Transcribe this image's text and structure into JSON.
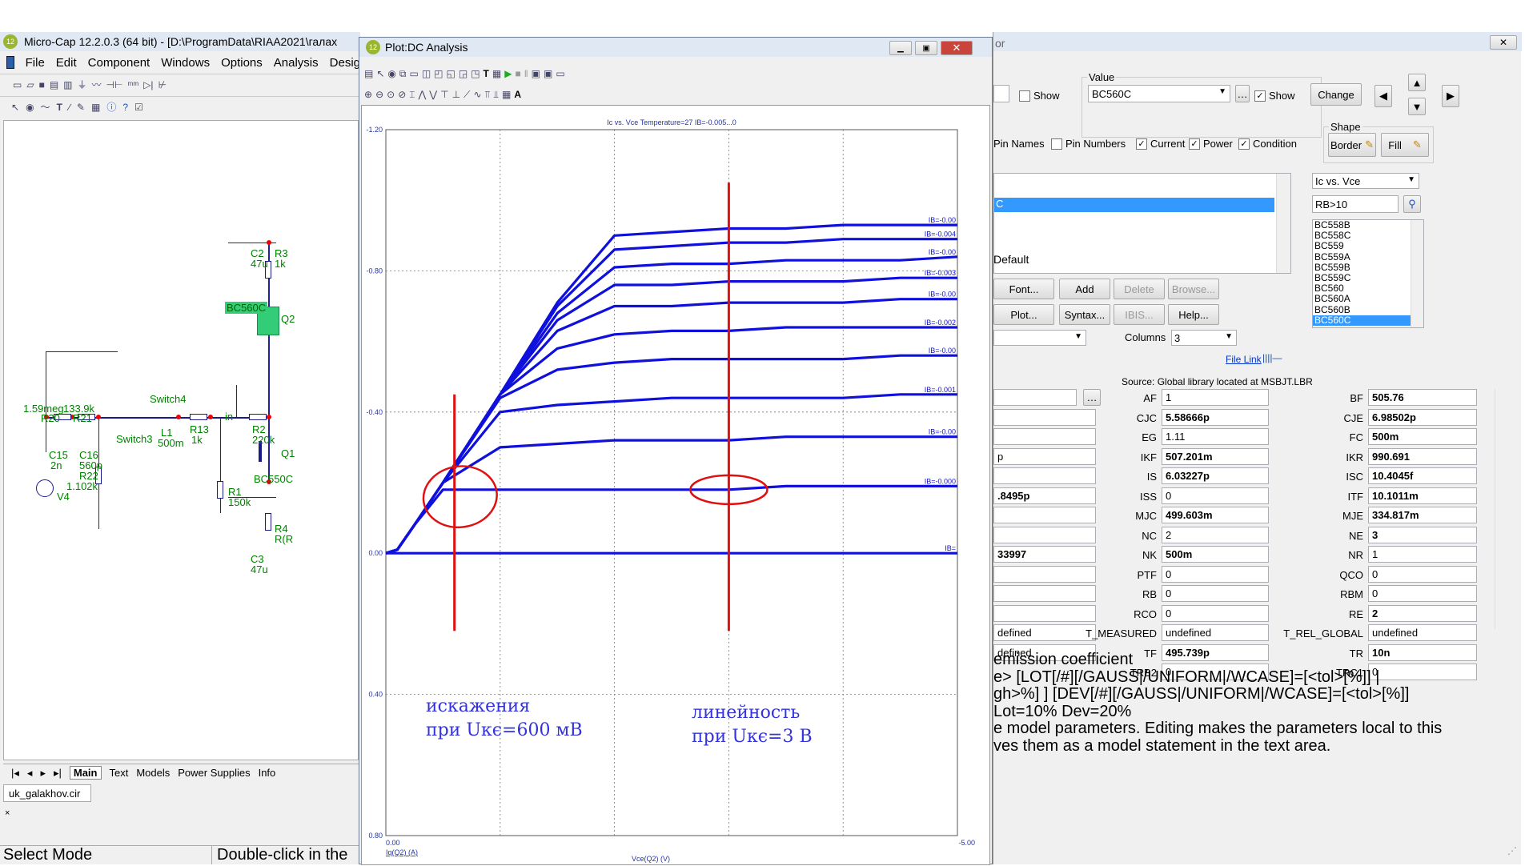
{
  "main": {
    "title": "Micro-Cap 12.2.0.3 (64 bit) - [D:\\ProgramData\\RIAA2021\\галах",
    "menu": [
      "File",
      "Edit",
      "Component",
      "Windows",
      "Options",
      "Analysis",
      "Desig"
    ],
    "tabs": [
      "Main",
      "Text",
      "Models",
      "Power Supplies",
      "Info"
    ],
    "file_tab": "uk_galakhov.cir",
    "status_left": "Select Mode",
    "status_right": "Double-click in the"
  },
  "schematic": {
    "labels": [
      "C2",
      "47u",
      "R3",
      "1k",
      "BC560C",
      "Q2",
      "1.59meg",
      "133.9k",
      "R20",
      "R21",
      "Switch4",
      "in",
      "R2",
      "220k",
      "Switch3",
      "L1",
      "500m",
      "R13",
      "1k",
      "C15",
      "2n",
      "C16",
      "560p",
      "R22",
      "1.102k",
      "V4",
      "Q1",
      "BC550C",
      "R1",
      "150k",
      "R4",
      "R(R",
      "C3",
      "47u"
    ]
  },
  "plot": {
    "title": "Plot:DC Analysis",
    "plot_caption": "Ic vs. Vce Temperature=27 IB=-0.005...0",
    "y_ticks": [
      "-1.20",
      "-0.80",
      "-0.40",
      "0.00",
      "0.40",
      "0.80"
    ],
    "x_ticks": [
      "0.00",
      "-5.00"
    ],
    "x_label": "Vce(Q2) (V)",
    "y_label": "Iq(Q2) (A)",
    "series_labels": [
      "IB=-0.00",
      "IB=-0.004",
      "IB=-0.00",
      "IB=-0.003",
      "IB=-0.00",
      "IB=-0.002",
      "IB=-0.00",
      "IB=-0.001",
      "IB=-0.00",
      "IB=-0.000",
      "IB="
    ],
    "annotation_left": [
      "искажения",
      "при Uкє=600 мВ"
    ],
    "annotation_right": [
      "линейность",
      "при Uкє=3 В"
    ],
    "curve_color": "#1010dd",
    "annotation_color": "#e01010"
  },
  "chart_data": {
    "type": "line",
    "title": "Ic vs. Vce Temperature=27 IB=-0.005...0",
    "xlabel": "Vce(Q2) (V)",
    "ylabel": "Iq(Q2) (A)",
    "xlim": [
      0,
      -5
    ],
    "ylim": [
      -1.2,
      0.8
    ],
    "x": [
      0,
      -0.1,
      -0.25,
      -0.5,
      -1,
      -1.5,
      -2,
      -2.5,
      -3,
      -3.5,
      -4,
      -4.5,
      -5
    ],
    "series": [
      {
        "name": "IB=-0.00",
        "values": [
          0,
          -0.01,
          -0.08,
          -0.2,
          -0.45,
          -0.71,
          -0.9,
          -0.91,
          -0.92,
          -0.92,
          -0.93,
          -0.93,
          -0.93
        ]
      },
      {
        "name": "IB=-0.004",
        "values": [
          0,
          -0.01,
          -0.08,
          -0.2,
          -0.45,
          -0.7,
          -0.86,
          -0.87,
          -0.88,
          -0.88,
          -0.89,
          -0.89,
          -0.89
        ]
      },
      {
        "name": "IB=-0.00",
        "values": [
          0,
          -0.01,
          -0.08,
          -0.2,
          -0.45,
          -0.68,
          -0.81,
          -0.82,
          -0.82,
          -0.83,
          -0.83,
          -0.83,
          -0.84
        ]
      },
      {
        "name": "IB=-0.003",
        "values": [
          0,
          -0.01,
          -0.08,
          -0.2,
          -0.45,
          -0.66,
          -0.76,
          -0.76,
          -0.77,
          -0.77,
          -0.77,
          -0.78,
          -0.78
        ]
      },
      {
        "name": "IB=-0.00",
        "values": [
          0,
          -0.01,
          -0.08,
          -0.2,
          -0.45,
          -0.63,
          -0.7,
          -0.7,
          -0.71,
          -0.71,
          -0.71,
          -0.72,
          -0.72
        ]
      },
      {
        "name": "IB=-0.002",
        "values": [
          0,
          -0.01,
          -0.08,
          -0.2,
          -0.45,
          -0.58,
          -0.62,
          -0.63,
          -0.63,
          -0.64,
          -0.64,
          -0.64,
          -0.64
        ]
      },
      {
        "name": "IB=-0.00",
        "values": [
          0,
          -0.01,
          -0.08,
          -0.2,
          -0.44,
          -0.52,
          -0.54,
          -0.55,
          -0.55,
          -0.55,
          -0.55,
          -0.56,
          -0.56
        ]
      },
      {
        "name": "IB=-0.001",
        "values": [
          0,
          -0.01,
          -0.08,
          -0.2,
          -0.4,
          -0.42,
          -0.43,
          -0.44,
          -0.44,
          -0.44,
          -0.44,
          -0.45,
          -0.45
        ]
      },
      {
        "name": "IB=-0.00",
        "values": [
          0,
          -0.01,
          -0.08,
          -0.2,
          -0.3,
          -0.31,
          -0.32,
          -0.32,
          -0.32,
          -0.33,
          -0.33,
          -0.33,
          -0.33
        ]
      },
      {
        "name": "IB=-0.000",
        "values": [
          0,
          -0.01,
          -0.08,
          -0.18,
          -0.18,
          -0.18,
          -0.18,
          -0.18,
          -0.18,
          -0.19,
          -0.19,
          -0.19,
          -0.19
        ]
      },
      {
        "name": "IB=",
        "values": [
          0,
          0,
          0,
          0,
          0,
          0,
          0,
          0,
          0,
          0,
          0,
          0,
          0
        ]
      }
    ]
  },
  "editor": {
    "title_fragment": "or",
    "show1": "Show",
    "value_label": "Value",
    "value": "BC560C",
    "show2": "Show",
    "change": "Change",
    "pin_names": "Pin Names",
    "pin_numbers": "Pin Numbers",
    "current": "Current",
    "power": "Power",
    "condition": "Condition",
    "shape_label": "Shape",
    "border": "Border",
    "fill": "Fill",
    "plot_select": "Ic vs. Vce",
    "filter": "RB>10",
    "models": [
      "BC558B",
      "BC558C",
      "BC559",
      "BC559A",
      "BC559B",
      "BC559C",
      "BC560",
      "BC560A",
      "BC560B",
      "BC560C"
    ],
    "selected_model": "BC560C",
    "list_item_selected": "C",
    "default_text": "Default",
    "buttons_row1": [
      "Font...",
      "Add",
      "Delete",
      "Browse..."
    ],
    "buttons_row2": [
      "Plot...",
      "Syntax...",
      "IBIS...",
      "Help..."
    ],
    "columns_label": "Columns",
    "columns_value": "3",
    "file_link": "File Link",
    "source": "Source: Global library located at MSBJT.LBR",
    "params_col0": [
      "",
      ".8495p",
      "",
      "33997",
      "",
      "",
      "",
      "defined",
      "defined"
    ],
    "params_col0b": [
      "p"
    ],
    "params_mid": [
      [
        "AF",
        "1"
      ],
      [
        "CJC",
        "5.58666p"
      ],
      [
        "EG",
        "1.11"
      ],
      [
        "IKF",
        "507.201m"
      ],
      [
        "IS",
        "6.03227p"
      ],
      [
        "ISS",
        "0"
      ],
      [
        "MJC",
        "499.603m"
      ],
      [
        "NC",
        "2"
      ],
      [
        "NK",
        "500m"
      ],
      [
        "PTF",
        "0"
      ],
      [
        "RB",
        "0"
      ],
      [
        "RCO",
        "0"
      ],
      [
        "T_MEASURED",
        "undefined"
      ],
      [
        "TF",
        "495.739p"
      ],
      [
        "TRB2",
        "0"
      ]
    ],
    "params_right": [
      [
        "BF",
        "505.76"
      ],
      [
        "CJE",
        "6.98502p"
      ],
      [
        "FC",
        "500m"
      ],
      [
        "IKR",
        "990.691"
      ],
      [
        "ISC",
        "10.4045f"
      ],
      [
        "ITF",
        "10.1011m"
      ],
      [
        "MJE",
        "334.817m"
      ],
      [
        "NE",
        "3"
      ],
      [
        "NR",
        "1"
      ],
      [
        "QCO",
        "0"
      ],
      [
        "RBM",
        "0"
      ],
      [
        "RE",
        "2"
      ],
      [
        "T_REL_GLOBAL",
        "undefined"
      ],
      [
        "TR",
        "10n"
      ],
      [
        "TRC1",
        "0"
      ]
    ],
    "help_lines": [
      "emission coefficient",
      "e> [LOT[/#][/GAUSS|/UNIFORM|/WCASE]=[<tol>[%]] |",
      "gh>%] ] [DEV[/#][/GAUSS|/UNIFORM|/WCASE]=[<tol>[%]]",
      "Lot=10% Dev=20%",
      "e model parameters. Editing makes the parameters local to this",
      "ves them as a model statement in the text area."
    ]
  }
}
